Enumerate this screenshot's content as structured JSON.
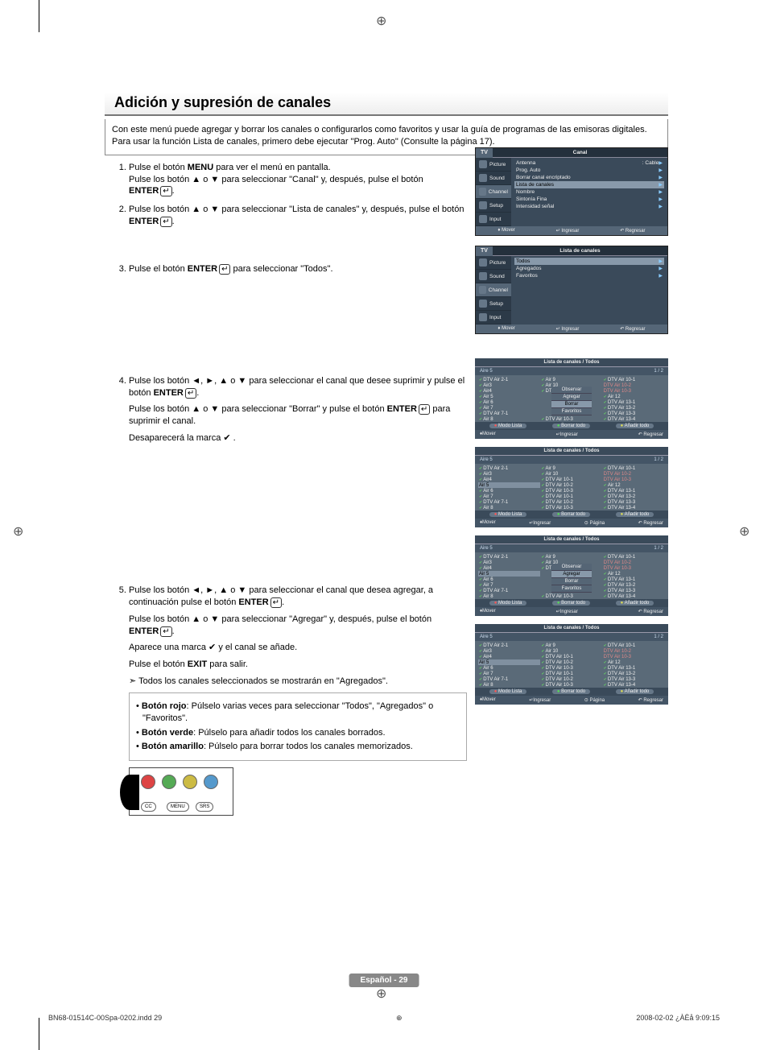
{
  "title": "Adición y supresión de canales",
  "intro": "Con este menú puede agregar y borrar los canales o configurarlos como favoritos y usar la guía de programas de las emisoras digitales. Para usar la función Lista de canales, primero debe ejecutar \"Prog. Auto\" (Consulte la página 17).",
  "steps": {
    "s1a": "Pulse el botón ",
    "s1b": "MENU",
    "s1c": " para ver el menú en pantalla.",
    "s1d": "Pulse los botón ▲ o ▼ para seleccionar \"Canal\" y, después, pulse el botón ",
    "s1e": "ENTER",
    "s1f": ".",
    "s2a": "Pulse los botón ▲ o ▼ para seleccionar \"Lista de canales\" y, después, pulse el botón ",
    "s2b": "ENTER",
    "s2c": ".",
    "s3a": "Pulse el botón ",
    "s3b": "ENTER",
    "s3c": " para seleccionar \"Todos\".",
    "s4a": "Pulse los botón ◄, ►, ▲ o ▼ para seleccionar el canal que desee suprimir y pulse el botón ",
    "s4b": "ENTER",
    "s4c": ".",
    "s4d": "Pulse los botón ▲ o ▼ para seleccionar \"Borrar\" y pulse el botón ",
    "s4e": "ENTER",
    "s4f": " para suprimir el canal.",
    "s4g": "Desaparecerá la marca ✔ .",
    "s5a": "Pulse los botón ◄, ►, ▲ o ▼ para seleccionar el canal que desea agregar, a continuación pulse el botón ",
    "s5b": "ENTER",
    "s5c": ".",
    "s5d": "Pulse los botón ▲ o ▼ para seleccionar \"Agregar\" y, después, pulse el botón ",
    "s5e": "ENTER",
    "s5f": ".",
    "s5g": "Aparece una marca ✔ y  el canal se añade.",
    "s5h": "Pulse el botón ",
    "s5i": "EXIT",
    "s5j": " para salir.",
    "s5note": "Todos los canales seleccionados se mostrarán en \"Agregados\"."
  },
  "bullets": {
    "b1a": "Botón rojo",
    "b1b": ": Púlselo varias veces para seleccionar \"Todos\", \"Agregados\" o \"Favoritos\".",
    "b2a": "Botón verde",
    "b2b": ": Púlselo para añadir todos los canales borrados.",
    "b3a": "Botón amarillo",
    "b3b": ": Púlselo para borrar todos los canales memorizados."
  },
  "remote": {
    "cc": "CC",
    "menu": "MENU",
    "srs": "SRS"
  },
  "osd1": {
    "tv": "TV",
    "title": "Canal",
    "side": [
      "Picture",
      "Sound",
      "Channel",
      "Setup",
      "Input"
    ],
    "rows": [
      {
        "l": "Antenna",
        "r": ": Cable"
      },
      {
        "l": "Prog. Auto",
        "r": ""
      },
      {
        "l": "Borrar canal encriptado",
        "r": ""
      },
      {
        "l": "Lista de canales",
        "r": "",
        "sel": true
      },
      {
        "l": "Nombre",
        "r": ""
      },
      {
        "l": "Sintonía Fina",
        "r": ""
      },
      {
        "l": "Intensidad señal",
        "r": ""
      }
    ],
    "ftr": [
      "♦ Mover",
      "↵ Ingresar",
      "↶ Regresar"
    ]
  },
  "osd2": {
    "tv": "TV",
    "title": "Lista de canales",
    "side": [
      "Picture",
      "Sound",
      "Channel",
      "Setup",
      "Input"
    ],
    "rows": [
      {
        "l": "Todos",
        "sel": true
      },
      {
        "l": "Agregados"
      },
      {
        "l": "Favoritos"
      }
    ],
    "ftr": [
      "♦ Mover",
      "↵ Ingresar",
      "↶ Regresar"
    ]
  },
  "chCommon": {
    "hdr": "Lista de canales / Todos",
    "aire": "Aire 5",
    "page": "1 / 2",
    "btns": {
      "modo": "Modo Lista",
      "borrar": "Borrar todo",
      "anadir": "Añadir todo"
    },
    "ftr": {
      "mover": "♦Mover",
      "ing": "↵Ingresar",
      "pag": "⊙ Página",
      "reg": "↶ Regresar"
    },
    "popup": {
      "obs": "Observar",
      "agr": "Agregar",
      "bor": "Borrar",
      "fav": "Favoritos"
    }
  },
  "ch1": {
    "c1": [
      "DTV Air 2-1",
      "Air3",
      "Air4",
      "Air 5",
      "Air 6",
      "Air 7",
      "DTV Air 7-1",
      "Air 8"
    ],
    "c2": [
      "Air 9",
      "Air 10",
      "DTV Air 10-1",
      "",
      "",
      "",
      "",
      "DTV Air 10-3"
    ],
    "c3": [
      "DTV Air 10-1",
      "DTV Air 10-2",
      "DTV Air 10-3",
      "Air 12",
      "DTV Air 13-1",
      "DTV Air 13-2",
      "DTV Air 13-3",
      "DTV Air 13-4"
    ]
  },
  "ch2": {
    "c1": [
      "DTV Air 2-1",
      "Air3",
      "Air4",
      "Air 5",
      "Air 6",
      "Air 7",
      "DTV Air 7-1",
      "Air 8"
    ],
    "c2": [
      "Air 9",
      "Air 10",
      "DTV Air 10-1",
      "DTV Air 10-2",
      "DTV Air 10-3",
      "DTV Air 10-1",
      "DTV Air 10-2",
      "DTV Air 10-3"
    ],
    "c3": [
      "DTV Air 10-1",
      "DTV Air 10-2",
      "DTV Air 10-3",
      "Air 12",
      "DTV Air 13-1",
      "DTV Air 13-2",
      "DTV Air 13-3",
      "DTV Air 13-4"
    ]
  },
  "ch3": {
    "c1": [
      "DTV Air 2-1",
      "Air3",
      "Air4",
      "Air 5",
      "Air 6",
      "Air 7",
      "DTV Air 7-1",
      "Air 8"
    ],
    "c2": [
      "Air 9",
      "Air 10",
      "DTV Air 10-1",
      "",
      "",
      "",
      "",
      "DTV Air 10-3"
    ],
    "c3": [
      "DTV Air 10-1",
      "DTV Air 10-2",
      "DTV Air 10-3",
      "Air 12",
      "DTV Air 13-1",
      "DTV Air 13-2",
      "DTV Air 13-3",
      "DTV Air 13-4"
    ]
  },
  "ch4": {
    "c1": [
      "DTV Air 2-1",
      "Air3",
      "Air4",
      "Air 5",
      "Air 6",
      "Air 7",
      "DTV Air 7-1",
      "Air 8"
    ],
    "c2": [
      "Air 9",
      "Air 10",
      "DTV Air 10-1",
      "DTV Air 10-2",
      "DTV Air 10-3",
      "DTV Air 10-1",
      "DTV Air 10-2",
      "DTV Air 10-3"
    ],
    "c3": [
      "DTV Air 10-1",
      "DTV Air 10-2",
      "DTV Air 10-3",
      "Air 12",
      "DTV Air 13-1",
      "DTV Air 13-2",
      "DTV Air 13-3",
      "DTV Air 13-4"
    ]
  },
  "pageLabel": "Español - 29",
  "footer": {
    "left": "BN68-01514C-00Spa-0202.indd   29",
    "right": "2008-02-02   ¿ÀÈå 9:09:15"
  }
}
